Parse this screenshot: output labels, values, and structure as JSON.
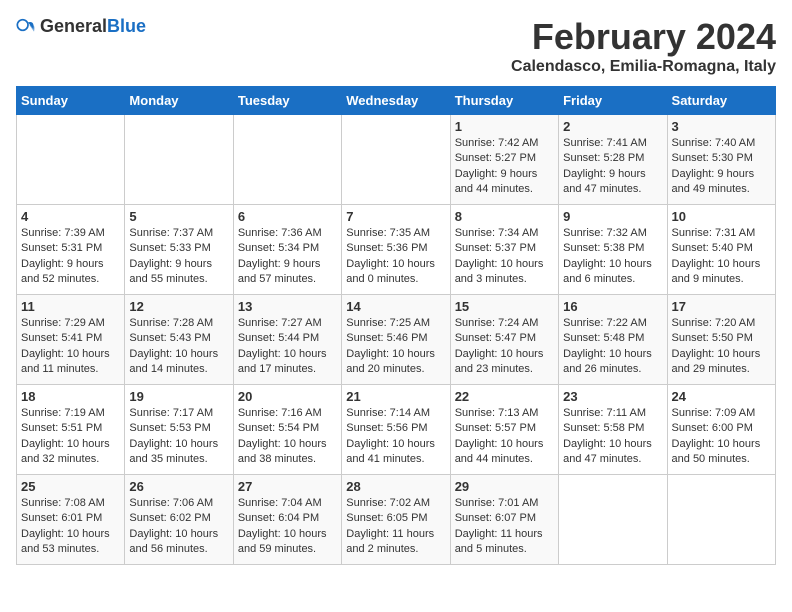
{
  "header": {
    "logo_general": "General",
    "logo_blue": "Blue",
    "main_title": "February 2024",
    "subtitle": "Calendasco, Emilia-Romagna, Italy"
  },
  "days_of_week": [
    "Sunday",
    "Monday",
    "Tuesday",
    "Wednesday",
    "Thursday",
    "Friday",
    "Saturday"
  ],
  "weeks": [
    [
      {
        "date": "",
        "sunrise": "",
        "sunset": "",
        "daylight": ""
      },
      {
        "date": "",
        "sunrise": "",
        "sunset": "",
        "daylight": ""
      },
      {
        "date": "",
        "sunrise": "",
        "sunset": "",
        "daylight": ""
      },
      {
        "date": "",
        "sunrise": "",
        "sunset": "",
        "daylight": ""
      },
      {
        "date": "1",
        "sunrise": "Sunrise: 7:42 AM",
        "sunset": "Sunset: 5:27 PM",
        "daylight": "Daylight: 9 hours and 44 minutes."
      },
      {
        "date": "2",
        "sunrise": "Sunrise: 7:41 AM",
        "sunset": "Sunset: 5:28 PM",
        "daylight": "Daylight: 9 hours and 47 minutes."
      },
      {
        "date": "3",
        "sunrise": "Sunrise: 7:40 AM",
        "sunset": "Sunset: 5:30 PM",
        "daylight": "Daylight: 9 hours and 49 minutes."
      }
    ],
    [
      {
        "date": "4",
        "sunrise": "Sunrise: 7:39 AM",
        "sunset": "Sunset: 5:31 PM",
        "daylight": "Daylight: 9 hours and 52 minutes."
      },
      {
        "date": "5",
        "sunrise": "Sunrise: 7:37 AM",
        "sunset": "Sunset: 5:33 PM",
        "daylight": "Daylight: 9 hours and 55 minutes."
      },
      {
        "date": "6",
        "sunrise": "Sunrise: 7:36 AM",
        "sunset": "Sunset: 5:34 PM",
        "daylight": "Daylight: 9 hours and 57 minutes."
      },
      {
        "date": "7",
        "sunrise": "Sunrise: 7:35 AM",
        "sunset": "Sunset: 5:36 PM",
        "daylight": "Daylight: 10 hours and 0 minutes."
      },
      {
        "date": "8",
        "sunrise": "Sunrise: 7:34 AM",
        "sunset": "Sunset: 5:37 PM",
        "daylight": "Daylight: 10 hours and 3 minutes."
      },
      {
        "date": "9",
        "sunrise": "Sunrise: 7:32 AM",
        "sunset": "Sunset: 5:38 PM",
        "daylight": "Daylight: 10 hours and 6 minutes."
      },
      {
        "date": "10",
        "sunrise": "Sunrise: 7:31 AM",
        "sunset": "Sunset: 5:40 PM",
        "daylight": "Daylight: 10 hours and 9 minutes."
      }
    ],
    [
      {
        "date": "11",
        "sunrise": "Sunrise: 7:29 AM",
        "sunset": "Sunset: 5:41 PM",
        "daylight": "Daylight: 10 hours and 11 minutes."
      },
      {
        "date": "12",
        "sunrise": "Sunrise: 7:28 AM",
        "sunset": "Sunset: 5:43 PM",
        "daylight": "Daylight: 10 hours and 14 minutes."
      },
      {
        "date": "13",
        "sunrise": "Sunrise: 7:27 AM",
        "sunset": "Sunset: 5:44 PM",
        "daylight": "Daylight: 10 hours and 17 minutes."
      },
      {
        "date": "14",
        "sunrise": "Sunrise: 7:25 AM",
        "sunset": "Sunset: 5:46 PM",
        "daylight": "Daylight: 10 hours and 20 minutes."
      },
      {
        "date": "15",
        "sunrise": "Sunrise: 7:24 AM",
        "sunset": "Sunset: 5:47 PM",
        "daylight": "Daylight: 10 hours and 23 minutes."
      },
      {
        "date": "16",
        "sunrise": "Sunrise: 7:22 AM",
        "sunset": "Sunset: 5:48 PM",
        "daylight": "Daylight: 10 hours and 26 minutes."
      },
      {
        "date": "17",
        "sunrise": "Sunrise: 7:20 AM",
        "sunset": "Sunset: 5:50 PM",
        "daylight": "Daylight: 10 hours and 29 minutes."
      }
    ],
    [
      {
        "date": "18",
        "sunrise": "Sunrise: 7:19 AM",
        "sunset": "Sunset: 5:51 PM",
        "daylight": "Daylight: 10 hours and 32 minutes."
      },
      {
        "date": "19",
        "sunrise": "Sunrise: 7:17 AM",
        "sunset": "Sunset: 5:53 PM",
        "daylight": "Daylight: 10 hours and 35 minutes."
      },
      {
        "date": "20",
        "sunrise": "Sunrise: 7:16 AM",
        "sunset": "Sunset: 5:54 PM",
        "daylight": "Daylight: 10 hours and 38 minutes."
      },
      {
        "date": "21",
        "sunrise": "Sunrise: 7:14 AM",
        "sunset": "Sunset: 5:56 PM",
        "daylight": "Daylight: 10 hours and 41 minutes."
      },
      {
        "date": "22",
        "sunrise": "Sunrise: 7:13 AM",
        "sunset": "Sunset: 5:57 PM",
        "daylight": "Daylight: 10 hours and 44 minutes."
      },
      {
        "date": "23",
        "sunrise": "Sunrise: 7:11 AM",
        "sunset": "Sunset: 5:58 PM",
        "daylight": "Daylight: 10 hours and 47 minutes."
      },
      {
        "date": "24",
        "sunrise": "Sunrise: 7:09 AM",
        "sunset": "Sunset: 6:00 PM",
        "daylight": "Daylight: 10 hours and 50 minutes."
      }
    ],
    [
      {
        "date": "25",
        "sunrise": "Sunrise: 7:08 AM",
        "sunset": "Sunset: 6:01 PM",
        "daylight": "Daylight: 10 hours and 53 minutes."
      },
      {
        "date": "26",
        "sunrise": "Sunrise: 7:06 AM",
        "sunset": "Sunset: 6:02 PM",
        "daylight": "Daylight: 10 hours and 56 minutes."
      },
      {
        "date": "27",
        "sunrise": "Sunrise: 7:04 AM",
        "sunset": "Sunset: 6:04 PM",
        "daylight": "Daylight: 10 hours and 59 minutes."
      },
      {
        "date": "28",
        "sunrise": "Sunrise: 7:02 AM",
        "sunset": "Sunset: 6:05 PM",
        "daylight": "Daylight: 11 hours and 2 minutes."
      },
      {
        "date": "29",
        "sunrise": "Sunrise: 7:01 AM",
        "sunset": "Sunset: 6:07 PM",
        "daylight": "Daylight: 11 hours and 5 minutes."
      },
      {
        "date": "",
        "sunrise": "",
        "sunset": "",
        "daylight": ""
      },
      {
        "date": "",
        "sunrise": "",
        "sunset": "",
        "daylight": ""
      }
    ]
  ]
}
